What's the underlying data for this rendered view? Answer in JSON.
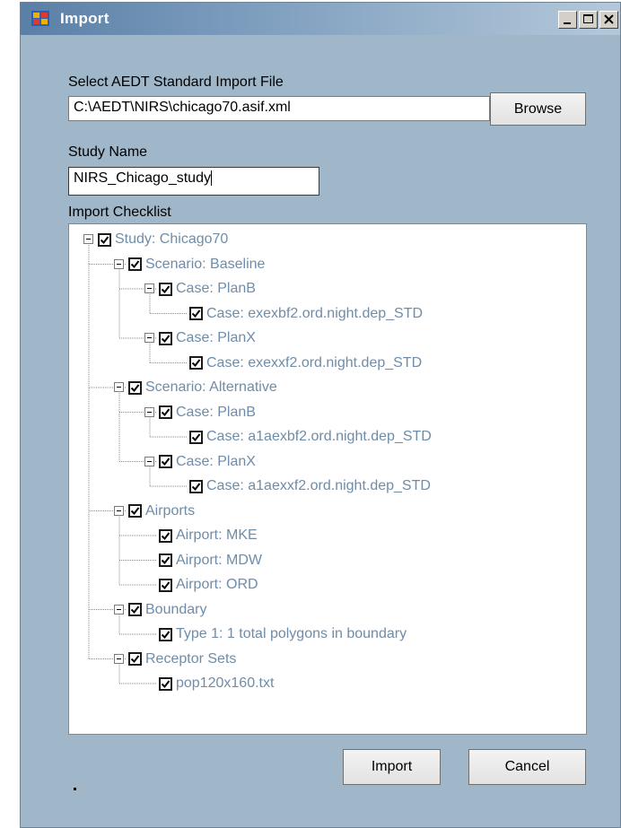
{
  "window": {
    "title": "Import"
  },
  "file": {
    "label": "Select AEDT Standard  Import File",
    "path": "C:\\AEDT\\NIRS\\chicago70.asif.xml",
    "browse_label": "Browse"
  },
  "study": {
    "label": "Study Name",
    "value": "NIRS_Chicago_study"
  },
  "checklist": {
    "label": "Import Checklist",
    "nodes": [
      {
        "label": "Study:  Chicago70",
        "level": 0,
        "expander": "minus",
        "checked": true
      },
      {
        "label": "Scenario:  Baseline",
        "level": 1,
        "expander": "minus",
        "checked": true
      },
      {
        "label": "Case:  PlanB",
        "level": 2,
        "expander": "minus",
        "checked": true
      },
      {
        "label": "Case:  exexbf2.ord.night.dep_STD",
        "level": 3,
        "expander": "none",
        "checked": true
      },
      {
        "label": "Case:  PlanX",
        "level": 2,
        "expander": "minus",
        "checked": true
      },
      {
        "label": "Case:  exexxf2.ord.night.dep_STD",
        "level": 3,
        "expander": "none",
        "checked": true
      },
      {
        "label": "Scenario:  Alternative",
        "level": 1,
        "expander": "minus",
        "checked": true
      },
      {
        "label": "Case:  PlanB",
        "level": 2,
        "expander": "minus",
        "checked": true
      },
      {
        "label": "Case:  a1aexbf2.ord.night.dep_STD",
        "level": 3,
        "expander": "none",
        "checked": true
      },
      {
        "label": "Case:  PlanX",
        "level": 2,
        "expander": "minus",
        "checked": true
      },
      {
        "label": "Case:  a1aexxf2.ord.night.dep_STD",
        "level": 3,
        "expander": "none",
        "checked": true
      },
      {
        "label": "Airports",
        "level": 1,
        "expander": "minus",
        "checked": true
      },
      {
        "label": "Airport:  MKE",
        "level": 2,
        "expander": "none",
        "checked": true
      },
      {
        "label": "Airport:  MDW",
        "level": 2,
        "expander": "none",
        "checked": true
      },
      {
        "label": "Airport:  ORD",
        "level": 2,
        "expander": "none",
        "checked": true
      },
      {
        "label": "Boundary",
        "level": 1,
        "expander": "minus",
        "checked": true
      },
      {
        "label": "Type 1:  1 total polygons in boundary",
        "level": 2,
        "expander": "none",
        "checked": true
      },
      {
        "label": "Receptor Sets",
        "level": 1,
        "expander": "minus",
        "checked": true
      },
      {
        "label": "pop120x160.txt",
        "level": 2,
        "expander": "none",
        "checked": true
      }
    ]
  },
  "actions": {
    "import_label": "Import",
    "cancel_label": "Cancel"
  },
  "icons": {
    "app": "import-app-icon",
    "minimize": "minimize-icon",
    "maximize": "maximize-icon",
    "close": "close-icon",
    "expander": "collapse-minus-icon",
    "checkbox": "checkbox-checked-icon"
  },
  "colors": {
    "window_bg": "#9fb7c9",
    "node_text": "#6f8ca8",
    "titlebar": "#5a7fa6"
  }
}
